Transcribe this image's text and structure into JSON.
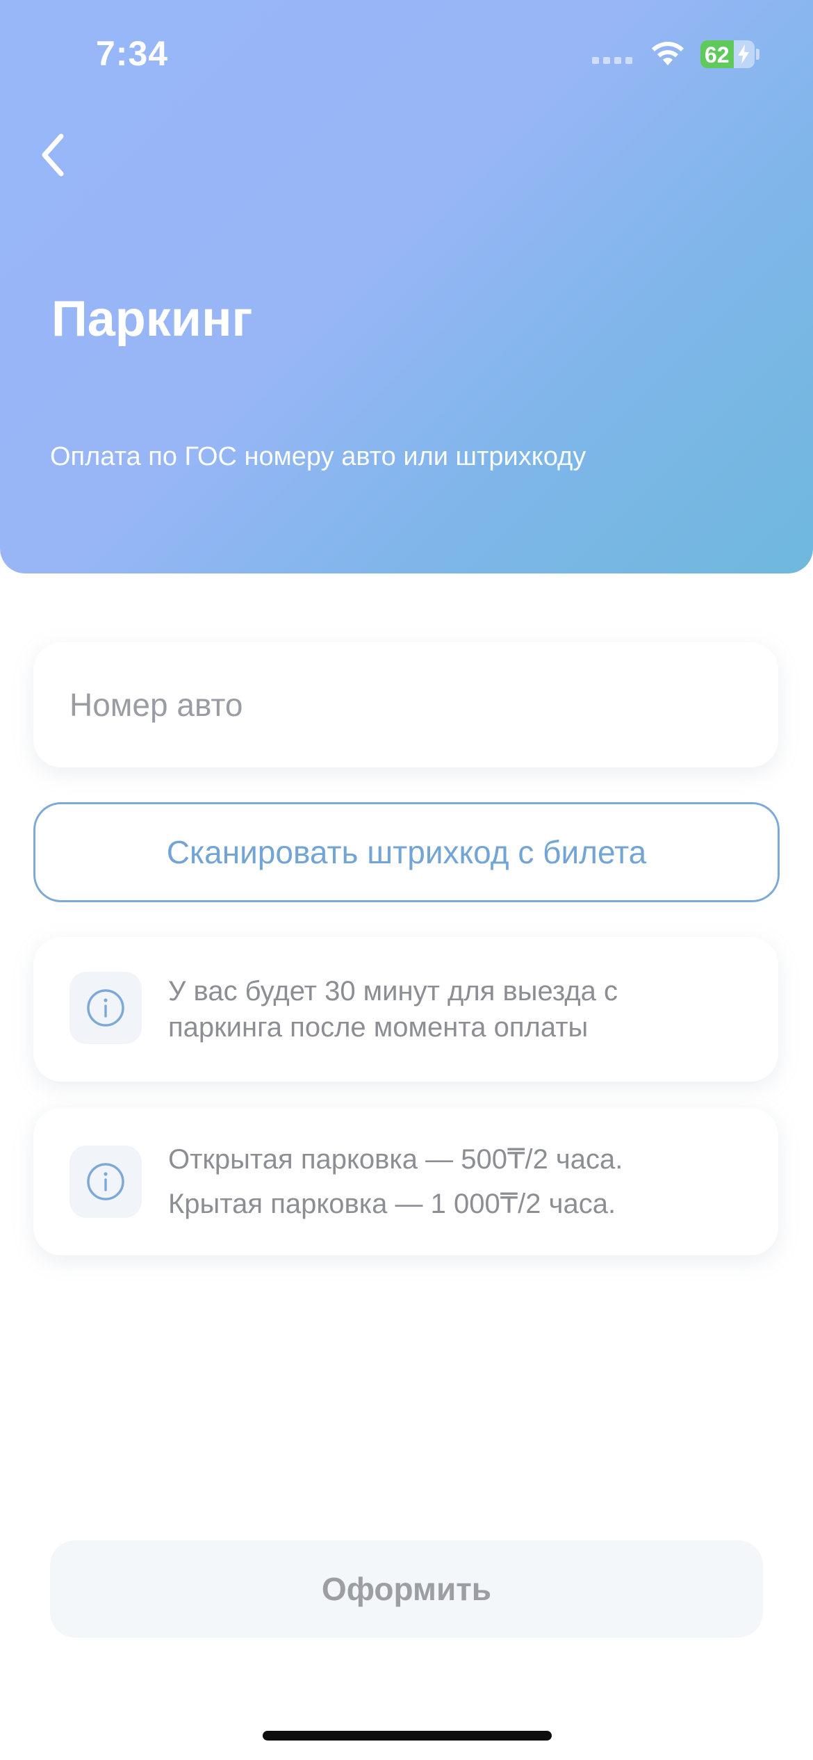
{
  "status_bar": {
    "time": "7:34",
    "battery_percent": "62",
    "battery_level": 0.62,
    "battery_color": "#5fc95c"
  },
  "header": {
    "back_icon": "chevron-left-icon",
    "title": "Паркинг",
    "subtitle": "Оплата по ГОС номеру авто или штрихкоду",
    "gradient_colors": [
      "#98b7f8",
      "#6fb8dc"
    ]
  },
  "form": {
    "car_number_placeholder": "Номер авто",
    "car_number_value": "",
    "scan_button_label": "Сканировать штрихкод с билета",
    "accent_color": "#72a4d6"
  },
  "info_cards": [
    {
      "icon": "info-icon",
      "lines": [
        "У вас будет 30 минут для выезда с",
        "паркинга после момента оплаты"
      ]
    },
    {
      "icon": "info-icon",
      "lines": [
        "Открытая парковка — 500₸/2 часа.",
        "Крытая парковка — 1 000₸/2 часа."
      ]
    }
  ],
  "submit": {
    "label": "Оформить"
  }
}
